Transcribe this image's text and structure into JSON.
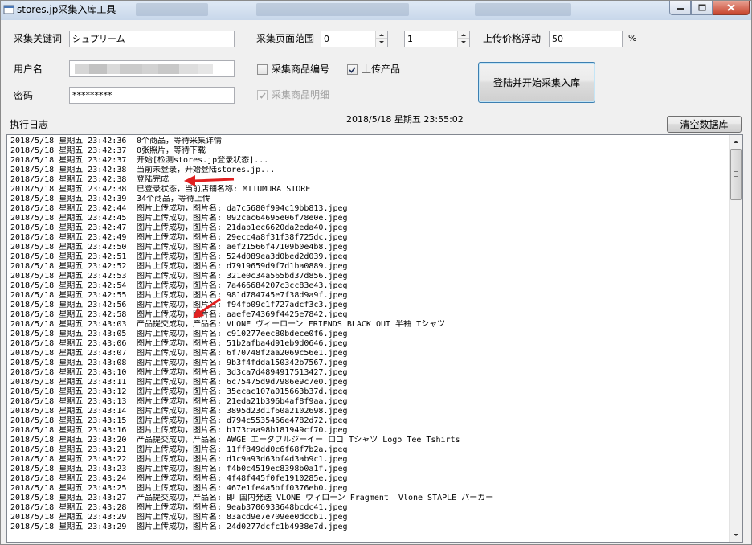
{
  "window": {
    "title": "stores.jp采集入库工具"
  },
  "form": {
    "keyword_label": "采集关键词",
    "keyword_value": "シュプリーム",
    "username_label": "用户名",
    "password_label": "密码",
    "password_value": "*********",
    "page_range_label": "采集页面范围",
    "page_range_from": "0",
    "page_range_sep": "-",
    "page_range_to": "1",
    "price_float_label": "上传价格浮动",
    "price_float_value": "50",
    "price_float_unit": "%",
    "cb_collect_item_no": {
      "label": "采集商品编号",
      "checked": false
    },
    "cb_upload_product": {
      "label": "上传产品",
      "checked": true
    },
    "cb_collect_detail": {
      "label": "采集商品明细",
      "checked": true,
      "disabled": true
    },
    "start_button": "登陆并开始采集入库"
  },
  "log_header": {
    "label": "执行日志",
    "datetime": "2018/5/18 星期五 23:55:02",
    "clear_button": "清空数据库"
  },
  "log": [
    {
      "ts": "2018/5/18 星期五 23:42:36",
      "msg": "0个商品，等待采集详情"
    },
    {
      "ts": "2018/5/18 星期五 23:42:37",
      "msg": "0张照片，等待下载"
    },
    {
      "ts": "2018/5/18 星期五 23:42:37",
      "msg": "开始[检测stores.jp登录状态]..."
    },
    {
      "ts": "2018/5/18 星期五 23:42:38",
      "msg": "当前未登录，开始登陆stores.jp..."
    },
    {
      "ts": "2018/5/18 星期五 23:42:38",
      "msg": "登陆完成"
    },
    {
      "ts": "2018/5/18 星期五 23:42:38",
      "msg": "已登录状态，当前店铺名称: MITUMURA STORE"
    },
    {
      "ts": "2018/5/18 星期五 23:42:39",
      "msg": "34个商品，等待上传"
    },
    {
      "ts": "2018/5/18 星期五 23:42:44",
      "msg": "图片上传成功，图片名: da7c5680f994c19bb813.jpeg"
    },
    {
      "ts": "2018/5/18 星期五 23:42:45",
      "msg": "图片上传成功，图片名: 092cac64695e06f78e0e.jpeg"
    },
    {
      "ts": "2018/5/18 星期五 23:42:47",
      "msg": "图片上传成功，图片名: 21dab1ec6620da2eda40.jpeg"
    },
    {
      "ts": "2018/5/18 星期五 23:42:49",
      "msg": "图片上传成功，图片名: 29ecc4a8f31f38f725dc.jpeg"
    },
    {
      "ts": "2018/5/18 星期五 23:42:50",
      "msg": "图片上传成功，图片名: aef21566f47109b0e4b8.jpeg"
    },
    {
      "ts": "2018/5/18 星期五 23:42:51",
      "msg": "图片上传成功，图片名: 524d089ea3d0bed2d039.jpeg"
    },
    {
      "ts": "2018/5/18 星期五 23:42:52",
      "msg": "图片上传成功，图片名: d7919659d9f7d1ba0889.jpeg"
    },
    {
      "ts": "2018/5/18 星期五 23:42:53",
      "msg": "图片上传成功，图片名: 321e0c34a565bd37d856.jpeg"
    },
    {
      "ts": "2018/5/18 星期五 23:42:54",
      "msg": "图片上传成功，图片名: 7a466684207c3cc83e43.jpeg"
    },
    {
      "ts": "2018/5/18 星期五 23:42:55",
      "msg": "图片上传成功，图片名: 981d784745e7f38d9a9f.jpeg"
    },
    {
      "ts": "2018/5/18 星期五 23:42:56",
      "msg": "图片上传成功，图片名: f94fb09c1f727adcf3c3.jpeg"
    },
    {
      "ts": "2018/5/18 星期五 23:42:58",
      "msg": "图片上传成功，图片名: aaefe74369f4425e7842.jpeg"
    },
    {
      "ts": "2018/5/18 星期五 23:43:03",
      "msg": "产品提交成功，产品名: VLONE ヴィーローン FRIENDS BLACK OUT 半袖 Tシャツ"
    },
    {
      "ts": "2018/5/18 星期五 23:43:05",
      "msg": "图片上传成功，图片名: c910277eec80bdece0f6.jpeg"
    },
    {
      "ts": "2018/5/18 星期五 23:43:06",
      "msg": "图片上传成功，图片名: 51b2afba4d91eb9d0646.jpeg"
    },
    {
      "ts": "2018/5/18 星期五 23:43:07",
      "msg": "图片上传成功，图片名: 6f70748f2aa2069c56e1.jpeg"
    },
    {
      "ts": "2018/5/18 星期五 23:43:08",
      "msg": "图片上传成功，图片名: 9b3f4fdda150342b7567.jpeg"
    },
    {
      "ts": "2018/5/18 星期五 23:43:10",
      "msg": "图片上传成功，图片名: 3d3ca7d4894917513427.jpeg"
    },
    {
      "ts": "2018/5/18 星期五 23:43:11",
      "msg": "图片上传成功，图片名: 6c75475d9d7986e9c7e0.jpeg"
    },
    {
      "ts": "2018/5/18 星期五 23:43:12",
      "msg": "图片上传成功，图片名: 35ecac107a015663b37d.jpeg"
    },
    {
      "ts": "2018/5/18 星期五 23:43:13",
      "msg": "图片上传成功，图片名: 21eda21b396b4af8f9aa.jpeg"
    },
    {
      "ts": "2018/5/18 星期五 23:43:14",
      "msg": "图片上传成功，图片名: 3895d23d1f60a2102698.jpeg"
    },
    {
      "ts": "2018/5/18 星期五 23:43:15",
      "msg": "图片上传成功，图片名: d794c5535466e4782d72.jpeg"
    },
    {
      "ts": "2018/5/18 星期五 23:43:16",
      "msg": "图片上传成功，图片名: b173caa98b181949cf70.jpeg"
    },
    {
      "ts": "2018/5/18 星期五 23:43:20",
      "msg": "产品提交成功，产品名: AWGE エーダブルジーイー ロゴ Tシャツ Logo Tee Tshirts"
    },
    {
      "ts": "2018/5/18 星期五 23:43:21",
      "msg": "图片上传成功，图片名: 11ff849dd0c6f68f7b2a.jpeg"
    },
    {
      "ts": "2018/5/18 星期五 23:43:22",
      "msg": "图片上传成功，图片名: d1c9a93d63bf4d3ab9c1.jpeg"
    },
    {
      "ts": "2018/5/18 星期五 23:43:23",
      "msg": "图片上传成功，图片名: f4b0c4519ec8398b0a1f.jpeg"
    },
    {
      "ts": "2018/5/18 星期五 23:43:24",
      "msg": "图片上传成功，图片名: 4f48f445f0fe1910285e.jpeg"
    },
    {
      "ts": "2018/5/18 星期五 23:43:25",
      "msg": "图片上传成功，图片名: 467e1fe4a5bff0376eb0.jpeg"
    },
    {
      "ts": "2018/5/18 星期五 23:43:27",
      "msg": "产品提交成功，产品名: 即 国内発送 VLONE ヴィローン Fragment  Vlone STAPLE パーカー"
    },
    {
      "ts": "2018/5/18 星期五 23:43:28",
      "msg": "图片上传成功，图片名: 9eab3706933648bcdc41.jpeg"
    },
    {
      "ts": "2018/5/18 星期五 23:43:29",
      "msg": "图片上传成功，图片名: 83acd9e7e709ee0dccb1.jpeg"
    },
    {
      "ts": "2018/5/18 星期五 23:43:29",
      "msg": "图片上传成功，图片名: 24d0277dcfc1b4938e7d.jpeg"
    }
  ],
  "colors": {
    "annotation_arrow": "#e02020",
    "title_gradient_top": "#dfe9f5",
    "close_button": "#c7432c"
  }
}
